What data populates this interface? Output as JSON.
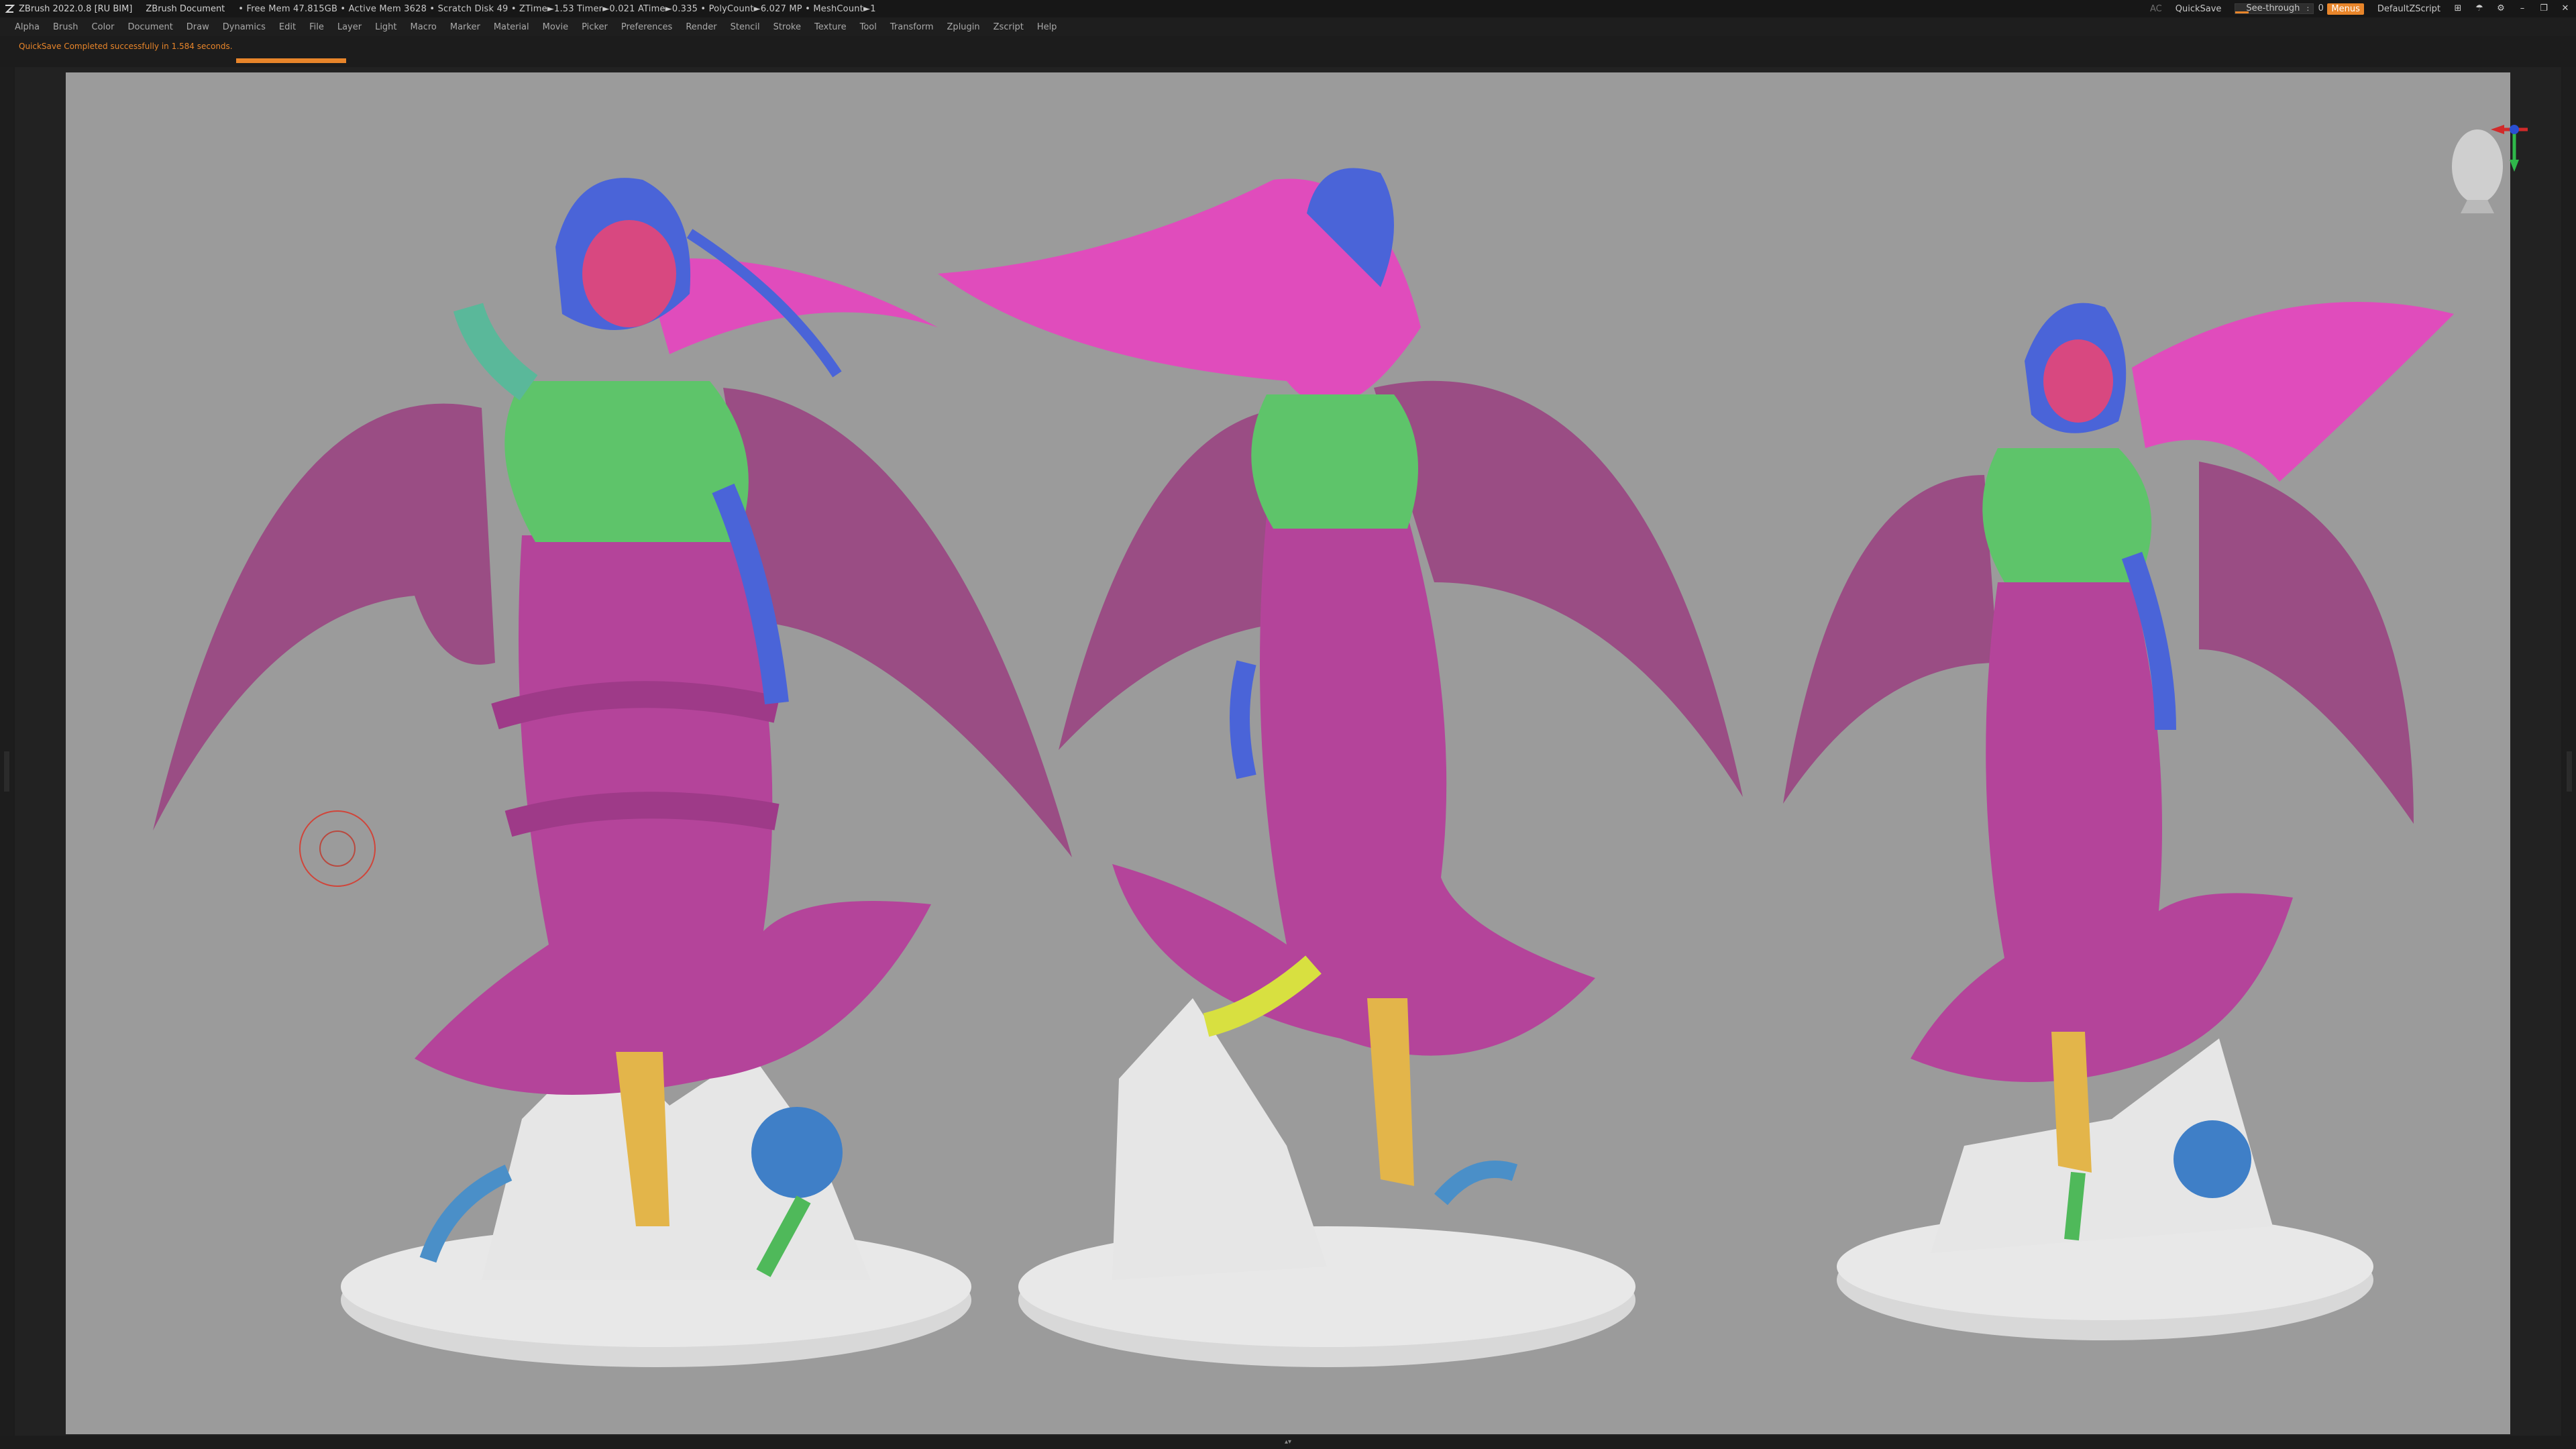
{
  "titlebar": {
    "app": "ZBrush 2022.0.8 [RU BIM]",
    "document": "ZBrush Document",
    "stats": "• Free Mem 47.815GB • Active Mem 3628 • Scratch Disk 49 • ZTime►1.53 Timer►0.021 ATime►0.335 • PolyCount►6.027 MP • MeshCount►1",
    "ac_label": "AC",
    "quicksave_label": "QuickSave",
    "seethrough_label": "See-through",
    "seethrough_value": "0",
    "menus_label": "Menus",
    "script_label": "DefaultZScript"
  },
  "menubar": {
    "items": [
      "Alpha",
      "Brush",
      "Color",
      "Document",
      "Draw",
      "Dynamics",
      "Edit",
      "File",
      "Layer",
      "Light",
      "Macro",
      "Marker",
      "Material",
      "Movie",
      "Picker",
      "Preferences",
      "Render",
      "Stencil",
      "Stroke",
      "Texture",
      "Tool",
      "Transform",
      "Zplugin",
      "Zscript",
      "Help"
    ]
  },
  "notification": {
    "message": "QuickSave Completed successfully in 1.584 seconds."
  },
  "colors": {
    "accent": "#e8852a",
    "canvas_bg": "#9b9b9b",
    "dress": "#b4449a",
    "wings": "#9a4d84",
    "hair_pink": "#e04cbc",
    "hair_blue": "#4a64d8",
    "top_green": "#5ec46a",
    "skin_pink": "#d84880",
    "legs_yellow": "#e3b54a",
    "base_white": "#e6e6e6",
    "bones_blue": "#4a8fc8"
  },
  "icons": [
    "zbrush-logo-icon",
    "minimize-icon",
    "maximize-icon",
    "close-icon",
    "navigation-head-icon",
    "axis-gizmo-icon",
    "brush-cursor-icon"
  ]
}
